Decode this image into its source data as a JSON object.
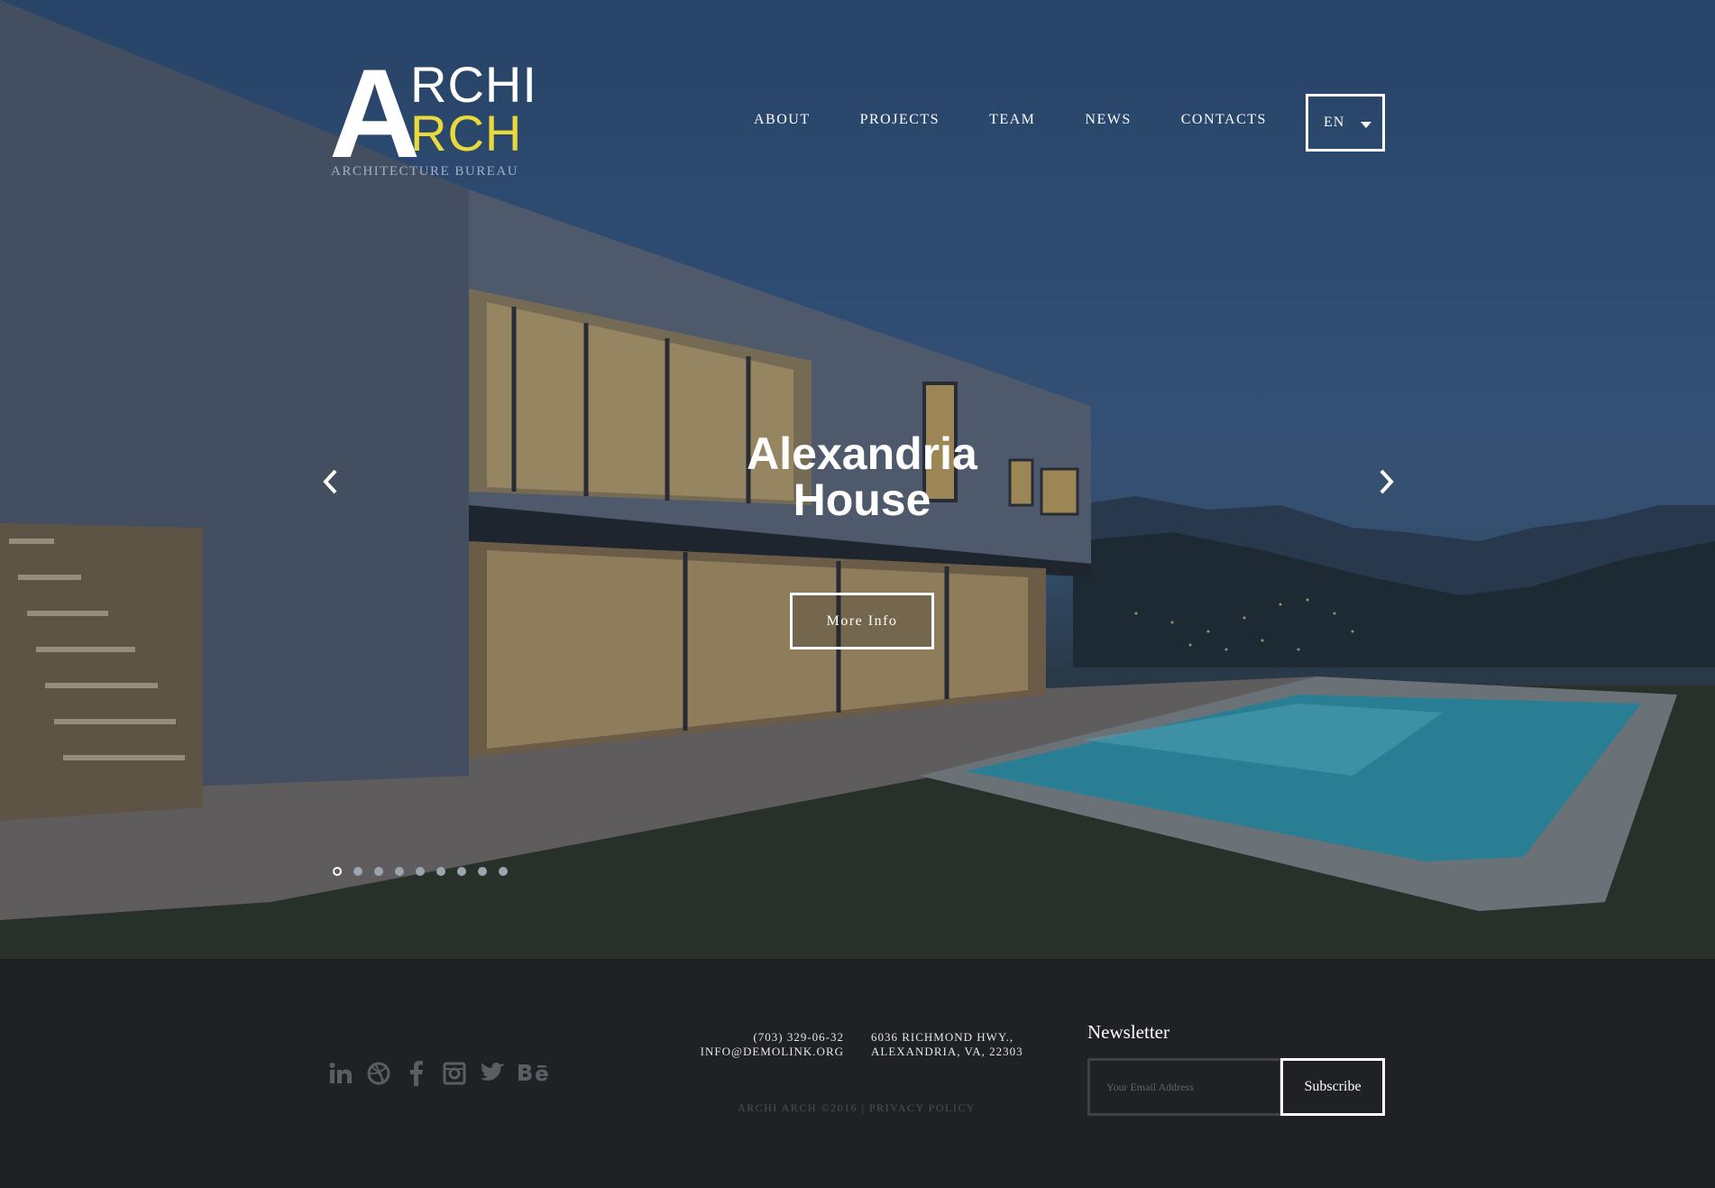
{
  "logo": {
    "letter": "A",
    "line1": "RCHI",
    "line2": "RCH",
    "tagline": "ARCHITECTURE BUREAU",
    "accent_color": "#e9d93a"
  },
  "nav": {
    "items": [
      {
        "label": "ABOUT"
      },
      {
        "label": "PROJECTS"
      },
      {
        "label": "TEAM"
      },
      {
        "label": "NEWS"
      },
      {
        "label": "CONTACTS"
      }
    ],
    "language": "EN"
  },
  "slider": {
    "title_line1": "Alexandria",
    "title_line2": "House",
    "button_label": "More Info",
    "prev_icon": "chevron-left-icon",
    "next_icon": "chevron-right-icon",
    "slide_count": 9,
    "active_slide": 1
  },
  "footer": {
    "social_icons": [
      "linkedin-icon",
      "dribbble-icon",
      "facebook-icon",
      "instagram-icon",
      "twitter-icon",
      "behance-icon"
    ],
    "phone": "(703) 329-06-32",
    "email": "INFO@DEMOLINK.ORG",
    "address_line1": "6036 RICHMOND HWY.,",
    "address_line2": "ALEXANDRIA, VA, 22303",
    "copyright": "ARCHI ARCH ©2016 | PRIVACY POLICY",
    "newsletter": {
      "title": "Newsletter",
      "placeholder": "Your Email Address",
      "button_label": "Subscribe"
    }
  }
}
